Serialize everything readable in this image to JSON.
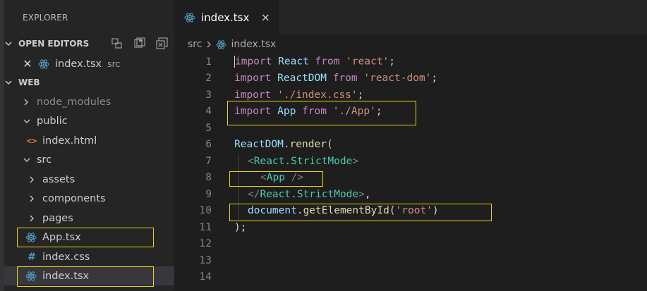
{
  "sidebar": {
    "title": "EXPLORER",
    "open_editors": {
      "label": "OPEN EDITORS",
      "files": [
        {
          "name": "index.tsx",
          "description": "src"
        }
      ]
    },
    "workspace": {
      "label": "WEB",
      "items": [
        {
          "label": "node_modules"
        },
        {
          "label": "public"
        },
        {
          "label": "index.html"
        },
        {
          "label": "src"
        },
        {
          "label": "assets"
        },
        {
          "label": "components"
        },
        {
          "label": "pages"
        },
        {
          "label": "App.tsx"
        },
        {
          "label": "index.css"
        },
        {
          "label": "index.tsx"
        }
      ]
    }
  },
  "editor": {
    "tab": {
      "label": "index.tsx",
      "close": "×"
    },
    "breadcrumb": {
      "folder": "src",
      "file": "index.tsx"
    },
    "lines": [
      {
        "n": "1"
      },
      {
        "n": "2"
      },
      {
        "n": "3"
      },
      {
        "n": "4"
      },
      {
        "n": "5"
      },
      {
        "n": "6"
      },
      {
        "n": "7"
      },
      {
        "n": "8"
      },
      {
        "n": "9"
      },
      {
        "n": "10"
      },
      {
        "n": "11"
      },
      {
        "n": "12"
      },
      {
        "n": "13"
      },
      {
        "n": "14"
      }
    ],
    "code": {
      "l1": [
        "import",
        "React",
        "from",
        "'react'",
        ";"
      ],
      "l2": [
        "import",
        "ReactDOM",
        "from",
        "'react-dom'",
        ";"
      ],
      "l3": [
        "import",
        "'./index.css'",
        ";"
      ],
      "l4": [
        "import",
        "App",
        "from",
        "'./App'",
        ";"
      ],
      "l6": [
        "ReactDOM",
        ".",
        "render",
        "("
      ],
      "l7": [
        "<",
        "React.StrictMode",
        ">"
      ],
      "l8": [
        "<",
        "App",
        " />"
      ],
      "l9": [
        "</",
        "React.StrictMode",
        ">",
        ","
      ],
      "l10": [
        "document",
        ".",
        "getElementById",
        "(",
        "'root'",
        ")"
      ],
      "l11": [
        ");"
      ]
    }
  },
  "colors": {
    "highlight": "#e8d800",
    "react_icon": "#519aba",
    "html_icon": "#e37933",
    "css_icon": "#519aba"
  },
  "icons": {
    "react": "react-file-icon",
    "html": "html-file-icon",
    "css": "css-file-icon",
    "chevron_right": "chevron-right-icon",
    "chevron_down": "chevron-down-icon"
  }
}
